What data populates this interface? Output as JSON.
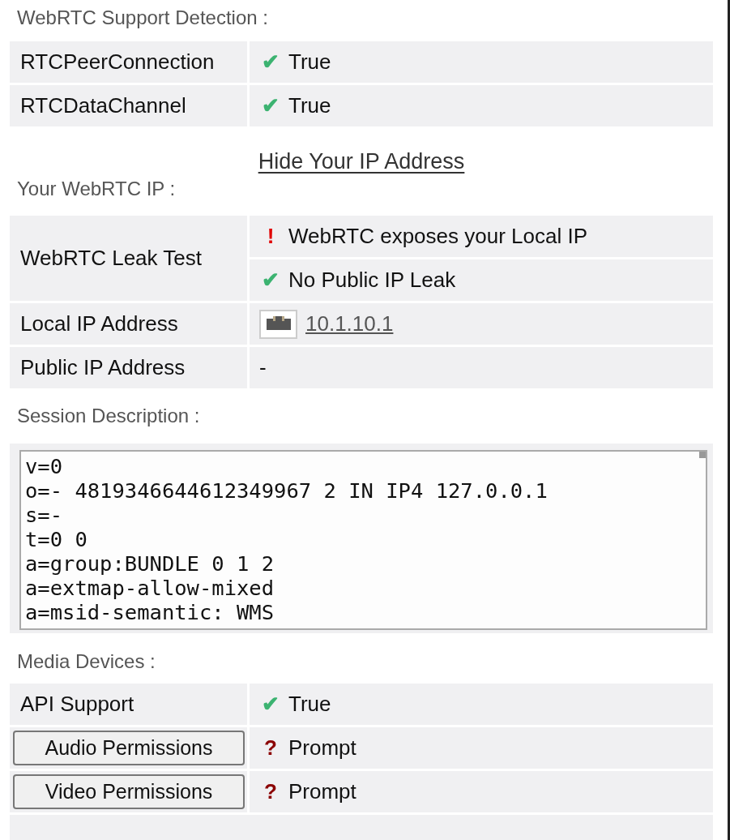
{
  "support": {
    "heading": "WebRTC Support Detection :",
    "rows": [
      {
        "label": "RTCPeerConnection",
        "color": "#3cb371",
        "icon": "✔",
        "value": "True"
      },
      {
        "label": "RTCDataChannel",
        "color": "#3cb371",
        "icon": "✔",
        "value": "True"
      }
    ]
  },
  "hide_link": "Hide Your IP Address",
  "webrtc_ip": {
    "heading": "Your WebRTC IP :",
    "leak_test": {
      "label": "WebRTC Leak Test",
      "results": [
        {
          "color": "#e00000",
          "icon": "!",
          "value": "WebRTC exposes your Local IP"
        },
        {
          "color": "#3cb371",
          "icon": "✔",
          "value": "No Public IP Leak"
        }
      ]
    },
    "rows": [
      {
        "label": "Local IP Address",
        "kind": "ip-link",
        "value": "10.1.10.1"
      },
      {
        "label": "Public IP Address",
        "kind": "text",
        "value": "-"
      }
    ]
  },
  "session": {
    "heading": "Session Description :",
    "lines": [
      "v=0",
      "o=- 4819346644612349967 2 IN IP4 127.0.0.1",
      "s=-",
      "t=0 0",
      "a=group:BUNDLE 0 1 2",
      "a=extmap-allow-mixed",
      "a=msid-semantic: WMS"
    ]
  },
  "media": {
    "heading": "Media Devices :",
    "rows": [
      {
        "kind": "label",
        "label": "API Support",
        "color": "#3cb371",
        "icon": "✔",
        "value": "True"
      },
      {
        "kind": "button",
        "label": "Audio Permissions",
        "color": "#8b0000",
        "icon": "?",
        "value": "Prompt"
      },
      {
        "kind": "button",
        "label": "Video Permissions",
        "color": "#8b0000",
        "icon": "?",
        "value": "Prompt"
      }
    ]
  }
}
